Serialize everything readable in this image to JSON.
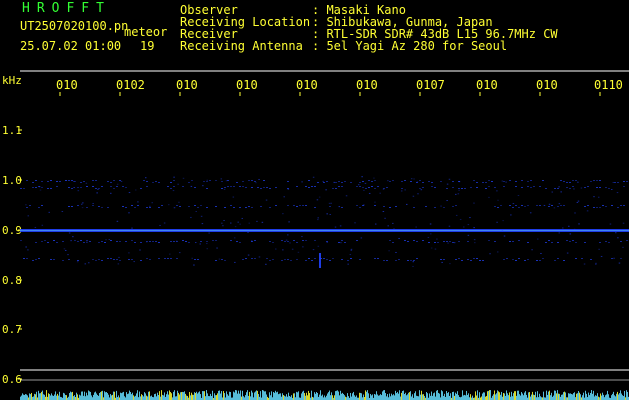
{
  "app": {
    "brand": "HROFFT",
    "filename": "UT2507020100.pn",
    "mode": "meteor",
    "datetime": "25.07.02 01:00",
    "count": "19"
  },
  "header": {
    "rows": [
      {
        "label": "Observer",
        "value": ": Masaki Kano"
      },
      {
        "label": "Receiving Location",
        "value": ": Shibukawa, Gunma, Japan"
      },
      {
        "label": "Receiver",
        "value": ": RTL-SDR SDR# 43dB L15 96.7MHz CW"
      },
      {
        "label": "Receiving Antenna",
        "value": ": 5el Yagi Az 280 for Seoul"
      }
    ]
  },
  "axis": {
    "unit": "kHz",
    "y_ticks": [
      "1.1",
      "1.0",
      "0.9",
      "0.8",
      "0.7",
      "0.6"
    ],
    "time_labels": [
      "010",
      "0102",
      "010",
      "010",
      "010",
      "010",
      "0107",
      "010",
      "010",
      "0110"
    ]
  },
  "colors": {
    "text_yellow": "#ffff33",
    "text_green": "#33ff33",
    "signal_blue": "#2244ff",
    "signal_cyan": "#66ddff",
    "grid_white": "#ffffff"
  }
}
